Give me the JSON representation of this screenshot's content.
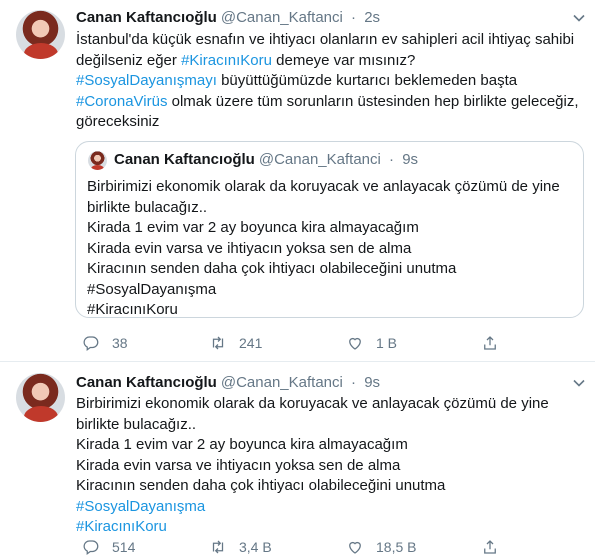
{
  "tweets": [
    {
      "name": "Canan Kaftancıoğlu",
      "handle": "@Canan_Kaftanci",
      "separator": "·",
      "time": "2s",
      "lines": [
        [
          {
            "t": "İstanbul'da küçük esnafın ve ihtiyacı olanların ev sahipleri acil ihtiyaç sahibi"
          }
        ],
        [
          {
            "t": "değilseniz eğer "
          },
          {
            "t": "#KiracınıKoru",
            "tag": true
          },
          {
            "t": " demeye var mısınız?"
          }
        ],
        [
          {
            "t": "#SosyalDayanışmayı",
            "tag": true
          },
          {
            "t": "  büyüttüğümüzde kurtarıcı beklemeden başta"
          }
        ],
        [
          {
            "t": "#CoronaVirüs",
            "tag": true
          },
          {
            "t": " olmak üzere tüm sorunların üstesinden hep birlikte geleceğiz,"
          }
        ],
        [
          {
            "t": "göreceksiniz"
          }
        ]
      ],
      "quote": {
        "name": "Canan Kaftancıoğlu",
        "handle": "@Canan_Kaftanci",
        "separator": "·",
        "time": "9s",
        "lines": [
          "Birbirimizi  ekonomik olarak da koruyacak ve anlayacak çözümü de yine",
          "birlikte bulacağız..",
          "Kirada 1 evim var 2 ay boyunca kira almayacağım",
          "Kirada evin varsa ve ihtiyacın yoksa sen de alma",
          "Kiracının senden daha çok ihtiyacı olabileceğini unutma",
          "#SosyalDayanışma",
          "#KiracınıKoru"
        ]
      },
      "actions": {
        "replies": "38",
        "retweets": "241",
        "likes": "1 B"
      }
    },
    {
      "name": "Canan Kaftancıoğlu",
      "handle": "@Canan_Kaftanci",
      "separator": "·",
      "time": "9s",
      "lines": [
        [
          {
            "t": "Birbirimizi  ekonomik olarak da koruyacak ve anlayacak çözümü de yine"
          }
        ],
        [
          {
            "t": "birlikte bulacağız.."
          }
        ],
        [
          {
            "t": "Kirada 1 evim var 2 ay boyunca kira almayacağım"
          }
        ],
        [
          {
            "t": "Kirada evin varsa ve ihtiyacın yoksa sen de alma"
          }
        ],
        [
          {
            "t": "Kiracının senden daha çok ihtiyacı olabileceğini unutma"
          }
        ],
        [
          {
            "t": "#SosyalDayanışma",
            "tag": true
          }
        ],
        [
          {
            "t": "#KiracınıKoru",
            "tag": true
          }
        ]
      ],
      "actions": {
        "replies": "514",
        "retweets": "3,4 B",
        "likes": "18,5 B"
      }
    }
  ],
  "icons": [
    "avatar",
    "chevron-down-icon",
    "reply-icon",
    "retweet-icon",
    "like-icon",
    "share-icon"
  ],
  "colors": {
    "link": "#1b95e0",
    "text": "#14171a",
    "muted": "#657786",
    "border": "#e6ecf0"
  }
}
